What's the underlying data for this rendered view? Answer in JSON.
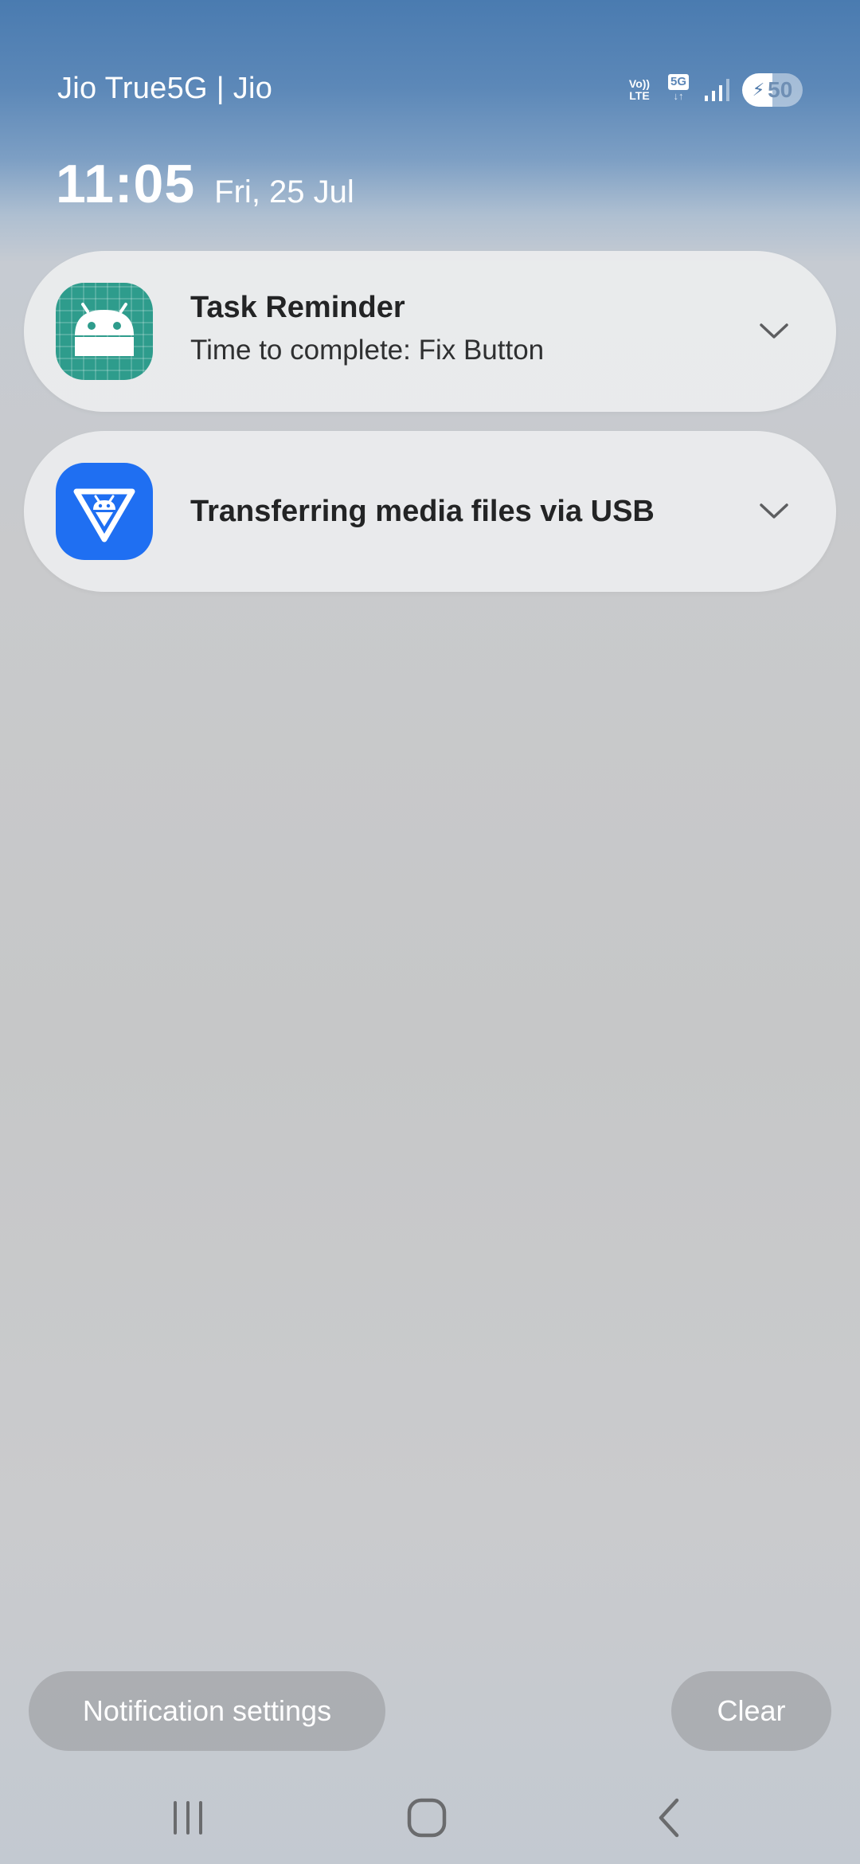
{
  "status_bar": {
    "carrier": "Jio True5G | Jio",
    "volte_top": "Vo))",
    "volte_bottom": "LTE",
    "network_type": "5G",
    "network_arrows": "↓↑",
    "battery_level": "50",
    "battery_charging": true,
    "signal_bars_filled": 3
  },
  "header": {
    "time": "11:05",
    "date": "Fri, 25 Jul"
  },
  "notifications": [
    {
      "app_icon": "android-robot-icon",
      "title": "Task Reminder",
      "body": "Time to complete: Fix Button",
      "icon_color": "#2e9c8c"
    },
    {
      "app_icon": "usb-android-transfer-icon",
      "title": "Transferring media files via USB",
      "icon_color": "#1f6ff2"
    }
  ],
  "actions": {
    "notification_settings_label": "Notification settings",
    "clear_label": "Clear"
  },
  "navigation": {
    "recents": "recents-icon",
    "home": "home-icon",
    "back": "back-icon"
  }
}
